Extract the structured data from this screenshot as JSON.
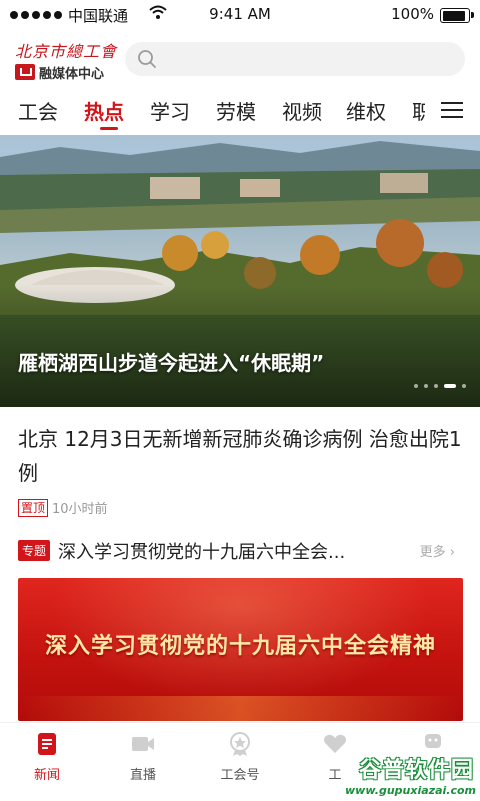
{
  "status_bar": {
    "carrier": "中国联通",
    "time": "9:41 AM",
    "battery_percent": "100%",
    "battery_level": 1.0,
    "signal_bars": 5
  },
  "header": {
    "logo_top": "北京市總工會",
    "logo_sub": "融媒体中心",
    "search_placeholder": ""
  },
  "channels": {
    "active_index": 1,
    "items": [
      {
        "label": "工会"
      },
      {
        "label": "热点"
      },
      {
        "label": "学习"
      },
      {
        "label": "劳模"
      },
      {
        "label": "视频"
      },
      {
        "label": "维权"
      },
      {
        "label": "职"
      }
    ]
  },
  "hero": {
    "caption": "雁栖湖西山步道今起进入“休眠期”",
    "slide_count": 5,
    "active_slide": 4
  },
  "news": {
    "title": "北京 12月3日无新增新冠肺炎确诊病例 治愈出院1例",
    "tag": "置顶",
    "time": "10小时前"
  },
  "topic": {
    "tag": "专题",
    "title": "深入学习贯彻党的十九届六中全会...",
    "more": "更多"
  },
  "banner": {
    "text": "深入学习贯彻党的十九届六中全会精神"
  },
  "tabbar": {
    "active_index": 0,
    "items": [
      {
        "label": "新闻",
        "icon": "news-document-icon"
      },
      {
        "label": "直播",
        "icon": "video-camera-icon"
      },
      {
        "label": "工会号",
        "icon": "badge-icon"
      },
      {
        "label": "工",
        "icon": "heart-icon"
      },
      {
        "label": "",
        "icon": "user-icon"
      }
    ]
  },
  "watermark": {
    "main": "谷普软件园",
    "url": "www.gupuxiazai.com"
  },
  "colors": {
    "accent": "#d2151a",
    "banner": "#c4130f",
    "watermark": "#1a8f3b"
  }
}
